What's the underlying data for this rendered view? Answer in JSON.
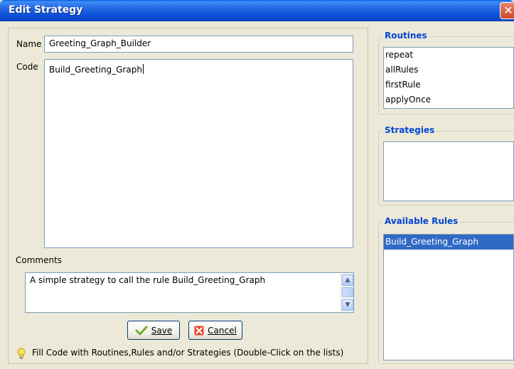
{
  "window": {
    "title": "Edit Strategy",
    "close_icon": "close-icon"
  },
  "form": {
    "name_label": "Name",
    "name_value": "Greeting_Graph_Builder",
    "code_label": "Code",
    "code_value": "Build_Greeting_Graph",
    "comments_label": "Comments",
    "comments_value": "A simple strategy to call the rule Build_Greeting_Graph"
  },
  "buttons": {
    "save_label": "Save",
    "cancel_label": "Cancel"
  },
  "hint": {
    "text": "Fill Code with Routines,Rules and/or Strategies (Double-Click on the lists)"
  },
  "routines": {
    "title": "Routines",
    "items": [
      "repeat",
      "allRules",
      "firstRule",
      "applyOnce"
    ]
  },
  "strategies": {
    "title": "Strategies",
    "items": []
  },
  "available_rules": {
    "title": "Available Rules",
    "items": [
      "Build_Greeting_Graph"
    ],
    "selected": "Build_Greeting_Graph"
  },
  "colors": {
    "title_bar": "#0a4fd6",
    "group_title": "#0046d5",
    "selection": "#316ac5",
    "dialog_bg": "#ece9d8"
  }
}
